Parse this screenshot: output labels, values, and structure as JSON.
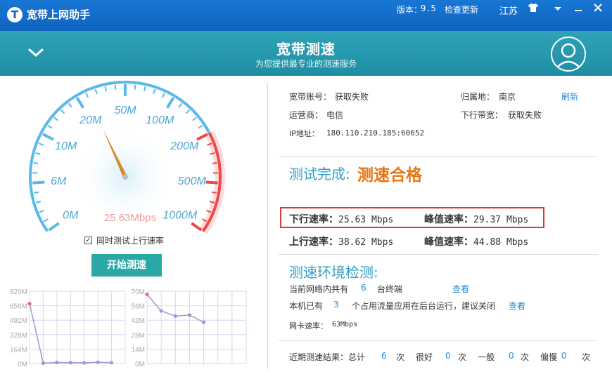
{
  "app": {
    "title": "宽带上网助手",
    "version_label": "版本：",
    "version": "9.5",
    "check_update": "检查更新",
    "region": "江苏"
  },
  "colors": {
    "titlebar": "#1170cc",
    "header": "#2a9db2",
    "accent_orange": "#e8750e",
    "accent_blue": "#2e9fc7",
    "gauge_blue": "#5ab9e8",
    "gauge_red": "#e94a4a",
    "highlight": "#d6393a",
    "button": "#2aa8a6"
  },
  "header": {
    "title": "宽带测速",
    "subtitle": "为您提供最专业的测速服务"
  },
  "gauge": {
    "ticks": [
      "0M",
      "6M",
      "10M",
      "20M",
      "50M",
      "100M",
      "200M",
      "500M",
      "1000M"
    ],
    "readout": "25.63Mbps",
    "needle_tick_position": 3.2
  },
  "controls": {
    "upload_checkbox_label": "同时测试上行速率",
    "upload_checked": true,
    "check_mark": "✓",
    "start_button": "开始测速"
  },
  "chart_data": [
    {
      "type": "line",
      "ylim": [
        0,
        820
      ],
      "yticks": [
        "820M",
        "656M",
        "492M",
        "328M",
        "164M",
        "0M"
      ],
      "x": [
        1,
        2,
        3,
        4,
        5,
        6,
        7
      ],
      "values": [
        680,
        5,
        12,
        10,
        8,
        15,
        10
      ]
    },
    {
      "type": "line",
      "ylim": [
        0,
        70
      ],
      "yticks": [
        "70M",
        "56M",
        "42M",
        "28M",
        "14M",
        "0M"
      ],
      "x": [
        1,
        2,
        3,
        4,
        5,
        6
      ],
      "values": [
        67,
        51,
        46,
        47,
        40
      ]
    }
  ],
  "info": {
    "account_label": "宽带账号：",
    "account_value": "获取失败",
    "location_label": "归属地：",
    "location_value": "南京",
    "refresh": "刷新",
    "isp_label": "运营商：",
    "isp_value": "电信",
    "bandwidth_label": "下行带宽：",
    "bandwidth_value": "获取失败",
    "ip_label": "IP地址：",
    "ip_value": "180.110.210.185:60652"
  },
  "result": {
    "label": "测试完成:",
    "value": "测速合格",
    "down_label": "下行速率：",
    "down_value": "25.63 Mbps",
    "down_peak_label": "峰值速率：",
    "down_peak_value": "29.37 Mbps",
    "up_label": "上行速率：",
    "up_value": "38.62 Mbps",
    "up_peak_label": "峰值速率：",
    "up_peak_value": "44.88 Mbps"
  },
  "env": {
    "title": "测速环境检测:",
    "devices_pre": "当前网络内共有",
    "devices_count": "6",
    "devices_post": "台终端",
    "view1": "查看",
    "apps_pre": "本机已有",
    "apps_count": "3",
    "apps_post": "个占用流量应用在后台运行，建议关闭",
    "view2": "查看",
    "nic_label": "网卡速率：",
    "nic_value": "63Mbps"
  },
  "recent": {
    "label": "近期测速结果：总计",
    "total": "6",
    "unit1": "次",
    "good_label": "很好",
    "good": "0",
    "unit2": "次",
    "normal_label": "一般",
    "normal": "0",
    "unit3": "次",
    "slow_label": "偏慢",
    "slow": "0",
    "unit4": "次"
  }
}
